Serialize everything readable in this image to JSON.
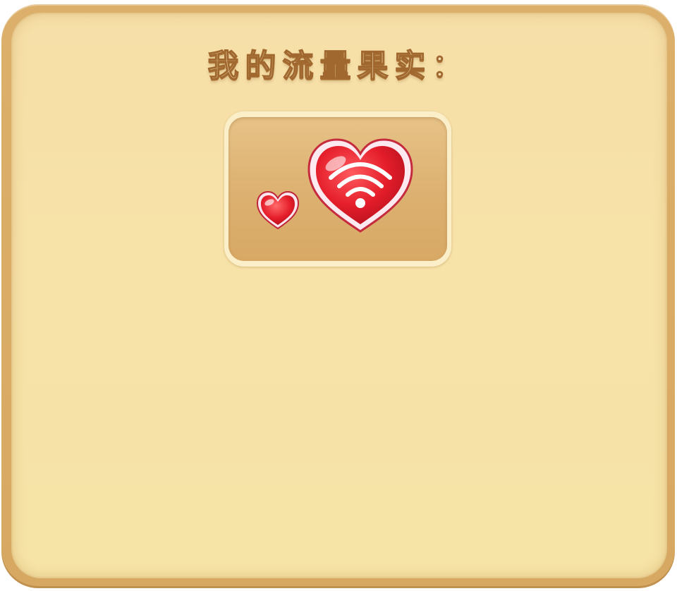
{
  "panel": {
    "title": "我的流量果实：",
    "colors": {
      "frame": "#dcb06a",
      "parchment": "#f7e2a8",
      "card": "#dcb070",
      "heart_red": "#e8202b"
    }
  },
  "fruit_card": {
    "small_icon": "heart-icon",
    "main_icon": "wifi-heart-icon"
  }
}
